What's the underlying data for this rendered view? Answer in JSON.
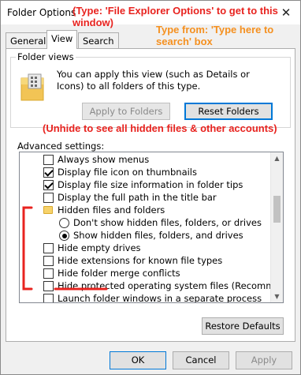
{
  "window": {
    "title": "Folder Options",
    "close_glyph": "✕"
  },
  "annotations": {
    "type_hint": "(Type: 'File Explorer Options' to get to this window)",
    "from_hint": "Type from: 'Type here to search' box",
    "unhide_hint": "(Unhide to see all hidden files & other accounts)",
    "colors": {
      "red": "#e8231f",
      "orange": "#f5901f"
    }
  },
  "tabs": [
    {
      "label": "General",
      "active": false
    },
    {
      "label": "View",
      "active": true
    },
    {
      "label": "Search",
      "active": false
    }
  ],
  "folder_views": {
    "legend": "Folder views",
    "description": "You can apply this view (such as Details or Icons) to all folders of this type.",
    "apply_button": "Apply to Folders",
    "reset_button": "Reset Folders"
  },
  "advanced": {
    "label": "Advanced settings:",
    "items": [
      {
        "type": "checkbox",
        "checked": false,
        "indent": 1,
        "label": "Always show menus"
      },
      {
        "type": "checkbox",
        "checked": true,
        "indent": 1,
        "label": "Display file icon on thumbnails"
      },
      {
        "type": "checkbox",
        "checked": true,
        "indent": 1,
        "label": "Display file size information in folder tips"
      },
      {
        "type": "checkbox",
        "checked": false,
        "indent": 1,
        "label": "Display the full path in the title bar"
      },
      {
        "type": "folder",
        "checked": false,
        "indent": 1,
        "label": "Hidden files and folders"
      },
      {
        "type": "radio",
        "checked": false,
        "indent": 2,
        "label": "Don't show hidden files, folders, or drives"
      },
      {
        "type": "radio",
        "checked": true,
        "indent": 2,
        "label": "Show hidden files, folders, and drives"
      },
      {
        "type": "checkbox",
        "checked": false,
        "indent": 1,
        "label": "Hide empty drives"
      },
      {
        "type": "checkbox",
        "checked": false,
        "indent": 1,
        "label": "Hide extensions for known file types"
      },
      {
        "type": "checkbox",
        "checked": false,
        "indent": 1,
        "label": "Hide folder merge conflicts"
      },
      {
        "type": "checkbox",
        "checked": false,
        "indent": 1,
        "label": "Hide protected operating system files (Recommended)"
      },
      {
        "type": "checkbox",
        "checked": false,
        "indent": 1,
        "label": "Launch folder windows in a separate process"
      }
    ],
    "restore_button": "Restore Defaults"
  },
  "footer": {
    "ok": "OK",
    "cancel": "Cancel",
    "apply": "Apply"
  }
}
